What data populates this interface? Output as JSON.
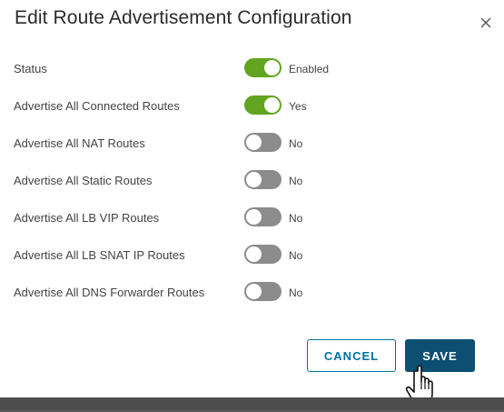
{
  "dialog": {
    "title": "Edit Route Advertisement Configuration",
    "close_icon": "close-icon"
  },
  "settings": [
    {
      "key": "status",
      "label": "Status",
      "enabled": true,
      "value": "Enabled"
    },
    {
      "key": "connected",
      "label": "Advertise All Connected Routes",
      "enabled": true,
      "value": "Yes"
    },
    {
      "key": "nat",
      "label": "Advertise All NAT Routes",
      "enabled": false,
      "value": "No"
    },
    {
      "key": "static",
      "label": "Advertise All Static Routes",
      "enabled": false,
      "value": "No"
    },
    {
      "key": "lb-vip",
      "label": "Advertise All LB VIP Routes",
      "enabled": false,
      "value": "No"
    },
    {
      "key": "lb-snat",
      "label": "Advertise All LB SNAT IP Routes",
      "enabled": false,
      "value": "No"
    },
    {
      "key": "dns-forwarder",
      "label": "Advertise All DNS Forwarder Routes",
      "enabled": false,
      "value": "No"
    }
  ],
  "footer": {
    "cancel_label": "CANCEL",
    "save_label": "SAVE"
  },
  "colors": {
    "toggle_on": "#62a420",
    "toggle_off": "#8c8c8c",
    "primary": "#0c4f72",
    "outline": "#0072a3"
  }
}
